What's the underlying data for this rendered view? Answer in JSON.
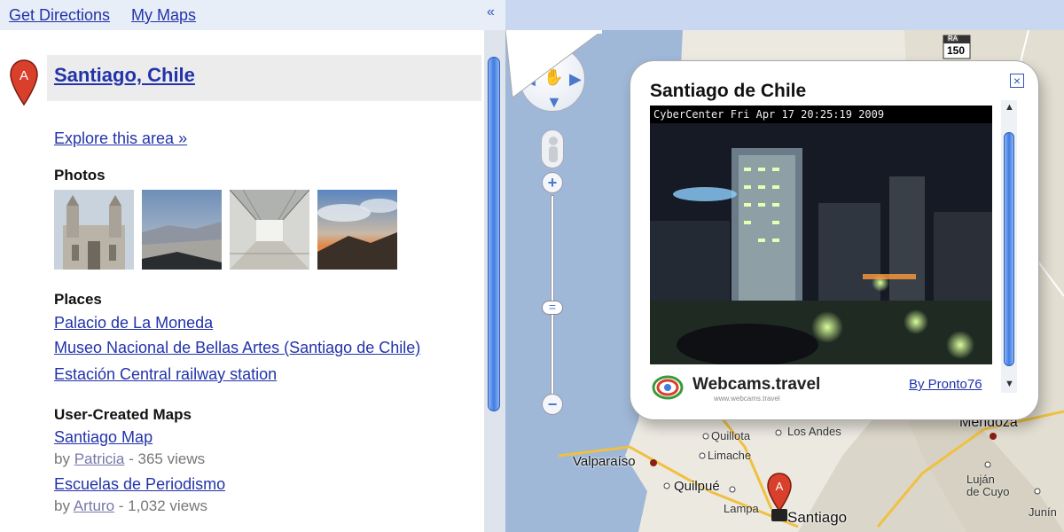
{
  "topbar": {
    "get_directions": "Get Directions",
    "my_maps": "My Maps",
    "collapse_glyph": "«"
  },
  "result": {
    "marker_letter": "A",
    "title": "Santiago, Chile",
    "explore": "Explore this area »"
  },
  "photos": {
    "heading": "Photos"
  },
  "places": {
    "heading": "Places",
    "items": [
      "Palacio de La Moneda",
      "Museo Nacional de Bellas Artes (Santiago de Chile)",
      "Estación Central railway station"
    ]
  },
  "user_maps": {
    "heading": "User-Created Maps",
    "items": [
      {
        "title": "Santiago Map",
        "by": "by",
        "author": "Patricia",
        "views": " - 365 views"
      },
      {
        "title": "Escuelas de Periodismo",
        "by": "by",
        "author": "Arturo",
        "views": " - 1,032 views"
      }
    ]
  },
  "map": {
    "zoom_in": "+",
    "zoom_out": "−",
    "route_shield": "150",
    "route_prefix": "RA",
    "labels": {
      "valparaiso": "Valparaíso",
      "quilpue": "Quilpué",
      "quillota": "Quillota",
      "limache": "Limache",
      "los_andes": "Los Andes",
      "lampa": "Lampa",
      "santiago": "Santiago",
      "mendoza": "Mendoza",
      "lujan": "Luján\nde Cuyo",
      "junin": "Junín"
    },
    "marker_letter": "A"
  },
  "bubble": {
    "title": "Santiago de Chile",
    "cam_caption": "CyberCenter  Fri Apr 17  20:25:19  2009",
    "logo_text": "Webcams.travel",
    "logo_sub": "www.webcams.travel",
    "byline": "By Pronto76",
    "close": "×"
  },
  "colors": {
    "link": "#2233aa",
    "water": "#9fb8d8",
    "land": "#ece9e1",
    "accent_blue": "#3f7de3",
    "marker_red": "#d9402b"
  }
}
